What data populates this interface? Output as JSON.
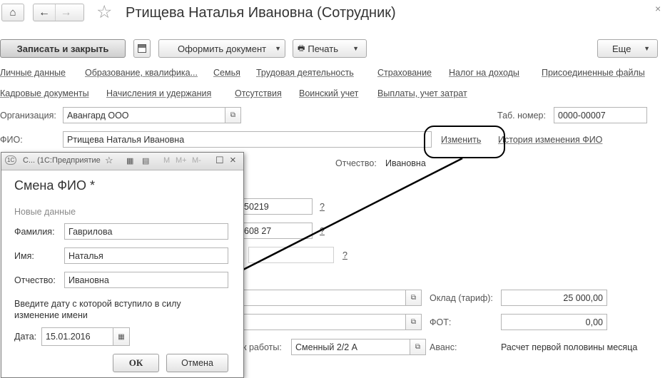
{
  "window": {
    "title": "Ртищева Наталья Ивановна (Сотрудник)"
  },
  "toolbar": {
    "save_close": "Записать и закрыть",
    "issue_doc": "Оформить документ",
    "print": "Печать",
    "more": "Еще"
  },
  "links_row1": [
    "Личные данные",
    "Образование, квалифика...",
    "Семья",
    "Трудовая деятельность",
    "Страхование",
    "Налог на доходы",
    "Присоединенные файлы"
  ],
  "links_row2": [
    "Кадровые документы",
    "Начисления и удержания",
    "Отсутствия",
    "Воинский учет",
    "Выплаты, учет затрат"
  ],
  "form": {
    "org_label": "Организация:",
    "org_value": "Авангард ООО",
    "tab_label": "Таб. номер:",
    "tab_value": "0000-00007",
    "fio_label": "ФИО:",
    "fio_value": "Ртищева Наталья Ивановна",
    "change_link": "Изменить",
    "history_link": "История изменения ФИО",
    "patronymic_label": "Отчество:",
    "patronymic_value": "Ивановна",
    "field_a": "50219",
    "field_b": "608 27",
    "q": "?",
    "salary_label": "Оклад (тариф):",
    "salary_value": "25 000,00",
    "fot_label": "ФОТ:",
    "fot_value": "0,00",
    "schedule_label": "к работы:",
    "schedule_value": "Сменный 2/2 А",
    "advance_label": "Аванс:",
    "advance_value": "Расчет первой половины месяца"
  },
  "dialog": {
    "window_title": "С...  (1С:Предприятие",
    "title": "Смена ФИО *",
    "section": "Новые данные",
    "surname_label": "Фамилия:",
    "surname_value": "Гаврилова",
    "name_label": "Имя:",
    "name_value": "Наталья",
    "patronymic_label": "Отчество:",
    "patronymic_value": "Ивановна",
    "hint": "Введите дату с которой вступило в силу изменение имени",
    "date_label": "Дата:",
    "date_value": "15.01.2016",
    "ok": "ОК",
    "cancel": "Отмена",
    "icons": {
      "m": "M",
      "mplus": "M+",
      "mminus": "M-"
    }
  },
  "colors": {
    "accent": "#333333",
    "callout": "#000000"
  }
}
